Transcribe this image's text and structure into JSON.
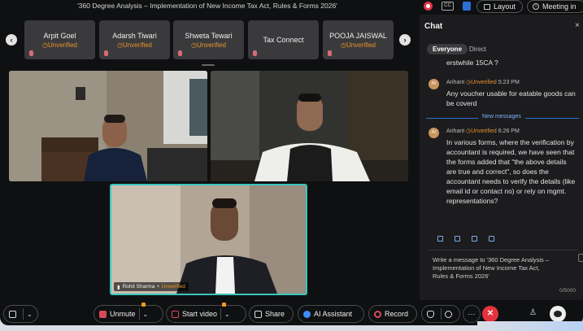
{
  "title_bar": {
    "meeting_title": "'360 Degree Analysis – Implementation of New Income Tax Act, Rules & Forms 2026'",
    "cc_label": "CC",
    "layout_label": "Layout",
    "meeting_info_label": "Meeting in"
  },
  "participants": [
    {
      "name": "Arpit Goel",
      "status": "Unverified"
    },
    {
      "name": "Adarsh Tiwari",
      "status": "Unverified"
    },
    {
      "name": "Shweta Tewari",
      "status": "Unverified"
    },
    {
      "name": "Tax Connect",
      "status": ""
    },
    {
      "name": "POOJA JAISWAL",
      "status": "Unverified"
    }
  ],
  "videos": {
    "speaker_name": "Rohit Sharma",
    "speaker_status": "Unverified"
  },
  "chat": {
    "title": "Chat",
    "close": "×",
    "tab_everyone": "Everyone",
    "tab_direct": "Direct",
    "prev_message": "erstwhile 15CA ?",
    "messages": [
      {
        "avatar": "Ar",
        "author": "Arihant",
        "status": "Unverified",
        "time": "5:23 PM",
        "text": "Any voucher usable for eatable goods can be coverd"
      },
      {
        "avatar": "Ar",
        "author": "Arihant",
        "status": "Unverified",
        "time": "6:26 PM",
        "text": "In various forms, where the verification by accountant is required, we have seen that the forms added that \"the above details are true and correct\", so does the accountant needs to verify the details (like email id or contact no) or rely on mgmt. representations?"
      }
    ],
    "new_messages_label": "New messages",
    "input_placeholder": "Write a message to '360 Degree Analysis – Implementation of New Income Tax Act, Rules & Forms 2026'",
    "char_count": "0/5000"
  },
  "controls": {
    "unmute": "Unmute",
    "start_video": "Start video",
    "share": "Share",
    "ai_assistant": "AI Assistant",
    "record": "Record",
    "more": "···",
    "leave": "✕"
  },
  "colors": {
    "unverified": "#e8922c",
    "active_speaker_border": "#37c7c0",
    "leave": "#e5333f",
    "new_messages": "#2d6fd2"
  }
}
